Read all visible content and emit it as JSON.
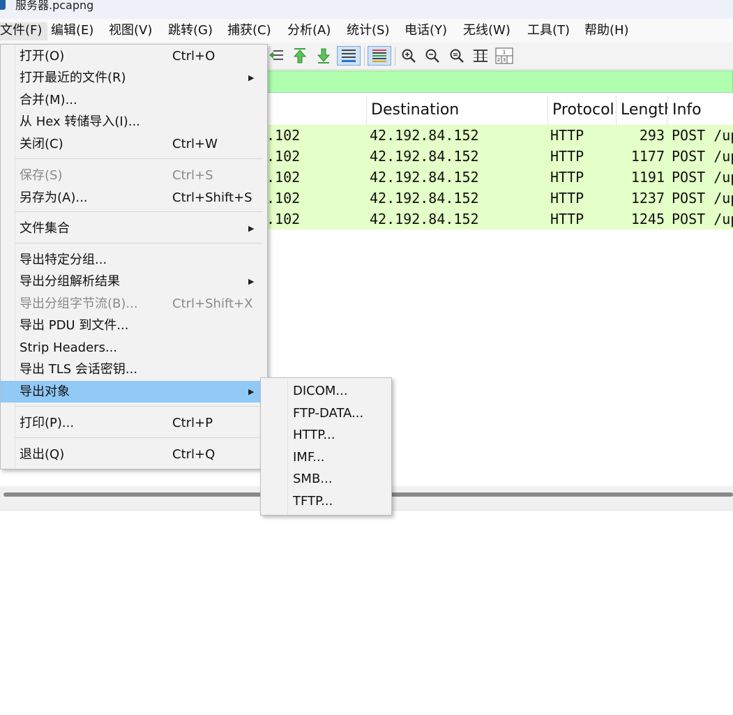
{
  "window": {
    "title": "服务器.pcapng"
  },
  "menubar": [
    "文件(F)",
    "编辑(E)",
    "视图(V)",
    "跳转(G)",
    "捕获(C)",
    "分析(A)",
    "统计(S)",
    "电话(Y)",
    "无线(W)",
    "工具(T)",
    "帮助(H)"
  ],
  "toolbar": {
    "icons": [
      "go-first-packet-icon",
      "go-last-packet-icon",
      "autoscroll-icon",
      "colorize-icon",
      "zoom-in-icon",
      "zoom-out-icon",
      "normal-size-icon",
      "resize-columns-icon",
      "layout-icon"
    ]
  },
  "colors": {
    "filter_bg": "#afffaf",
    "row_bg": "#e4ffc7",
    "highlight": "#91c9f7"
  },
  "packet_list": {
    "columns": [
      "Destination",
      "Protocol",
      "Length",
      "Info"
    ],
    "rows": [
      {
        "source": ".102",
        "destination": "42.192.84.152",
        "protocol": "HTTP",
        "length": "293",
        "info": "POST /up"
      },
      {
        "source": ".102",
        "destination": "42.192.84.152",
        "protocol": "HTTP",
        "length": "1177",
        "info": "POST /up"
      },
      {
        "source": ".102",
        "destination": "42.192.84.152",
        "protocol": "HTTP",
        "length": "1191",
        "info": "POST /up"
      },
      {
        "source": ".102",
        "destination": "42.192.84.152",
        "protocol": "HTTP",
        "length": "1237",
        "info": "POST /up"
      },
      {
        "source": ".102",
        "destination": "42.192.84.152",
        "protocol": "HTTP",
        "length": "1245",
        "info": "POST /up"
      }
    ]
  },
  "file_menu": {
    "items": [
      {
        "label": "打开(O)",
        "shortcut": "Ctrl+O"
      },
      {
        "label": "打开最近的文件(R)",
        "arrow": "▶"
      },
      {
        "label": "合并(M)..."
      },
      {
        "label": "从 Hex 转储导入(I)..."
      },
      {
        "label": "关闭(C)",
        "shortcut": "Ctrl+W"
      },
      {
        "label": "保存(S)",
        "shortcut": "Ctrl+S"
      },
      {
        "label": "另存为(A)...",
        "shortcut": "Ctrl+Shift+S"
      },
      {
        "label": "文件集合",
        "arrow": "▶"
      },
      {
        "label": "导出特定分组..."
      },
      {
        "label": "导出分组解析结果",
        "arrow": "▶"
      },
      {
        "label": "导出分组字节流(B)...",
        "shortcut": "Ctrl+Shift+X"
      },
      {
        "label": "导出 PDU 到文件..."
      },
      {
        "label": "Strip Headers..."
      },
      {
        "label": "导出 TLS 会话密钥..."
      },
      {
        "label": "导出对象",
        "arrow": "▶"
      },
      {
        "label": "打印(P)...",
        "shortcut": "Ctrl+P"
      },
      {
        "label": "退出(Q)",
        "shortcut": "Ctrl+Q"
      }
    ]
  },
  "export_objects_submenu": [
    "DICOM...",
    "FTP-DATA...",
    "HTTP...",
    "IMF...",
    "SMB...",
    "TFTP..."
  ]
}
